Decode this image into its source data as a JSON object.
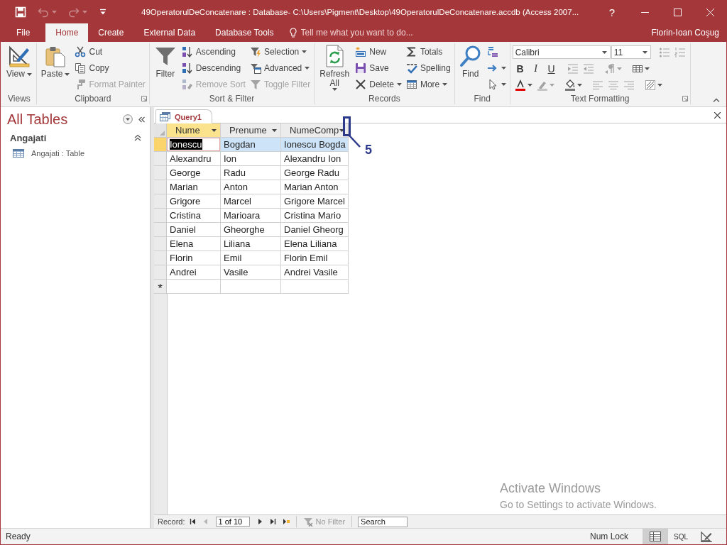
{
  "window": {
    "title": "49OperatorulDeConcatenare : Database- C:\\Users\\Pigment\\Desktop\\49OperatorulDeConcatenare.accdb (Access 2007...",
    "help": "?"
  },
  "quick_access": [
    {
      "kind": "save",
      "disabled": false,
      "dropdown": false
    },
    {
      "kind": "undo",
      "disabled": true,
      "dropdown": true
    },
    {
      "kind": "redo",
      "disabled": true,
      "dropdown": true
    },
    {
      "kind": "customize",
      "disabled": false,
      "dropdown": false
    }
  ],
  "ribbon_tabs": [
    {
      "label": "File",
      "selected": false
    },
    {
      "label": "Home",
      "selected": true
    },
    {
      "label": "Create",
      "selected": false
    },
    {
      "label": "External Data",
      "selected": false
    },
    {
      "label": "Database Tools",
      "selected": false
    }
  ],
  "tell_me": {
    "placeholder": "Tell me what you want to do..."
  },
  "user": "Florin-Ioan Coşug",
  "ribbon_groups": [
    {
      "label": "Views",
      "dialog_launcher": false,
      "large": {
        "kind": "view",
        "label": "View",
        "dropdown": true,
        "disabled": false
      }
    },
    {
      "label": "Clipboard",
      "dialog_launcher": true,
      "large": {
        "kind": "paste",
        "label": "Paste",
        "dropdown": true,
        "disabled": false
      },
      "columns": [
        [
          {
            "kind": "cut",
            "label": "Cut",
            "dropdown": false,
            "disabled": false
          },
          {
            "kind": "copy",
            "label": "Copy",
            "dropdown": false,
            "disabled": false
          },
          {
            "kind": "formatpainter",
            "label": "Format Painter",
            "dropdown": false,
            "disabled": true
          }
        ]
      ]
    },
    {
      "label": "Sort & Filter",
      "dialog_launcher": false,
      "large": {
        "kind": "filter",
        "label": "Filter",
        "dropdown": false,
        "disabled": false
      },
      "columns": [
        [
          {
            "kind": "ascending",
            "label": "Ascending",
            "dropdown": false,
            "disabled": false
          },
          {
            "kind": "descending",
            "label": "Descending",
            "dropdown": false,
            "disabled": false
          },
          {
            "kind": "removesort",
            "label": "Remove Sort",
            "dropdown": false,
            "disabled": true
          }
        ],
        [
          {
            "kind": "selection",
            "label": "Selection",
            "dropdown": true,
            "disabled": false
          },
          {
            "kind": "advanced",
            "label": "Advanced",
            "dropdown": true,
            "disabled": false
          },
          {
            "kind": "togglefilter",
            "label": "Toggle Filter",
            "dropdown": false,
            "disabled": true
          }
        ]
      ]
    },
    {
      "label": "Records",
      "dialog_launcher": false,
      "large": {
        "kind": "refresh",
        "label": "Refresh All",
        "dropdown": true,
        "disabled": false
      },
      "columns": [
        [
          {
            "kind": "new",
            "label": "New",
            "dropdown": false,
            "disabled": false
          },
          {
            "kind": "save",
            "label": "Save",
            "dropdown": false,
            "disabled": false
          },
          {
            "kind": "delete",
            "label": "Delete",
            "dropdown": true,
            "disabled": false
          }
        ],
        [
          {
            "kind": "totals",
            "label": "Totals",
            "dropdown": false,
            "disabled": false
          },
          {
            "kind": "spelling",
            "label": "Spelling",
            "dropdown": false,
            "disabled": false
          },
          {
            "kind": "more",
            "label": "More",
            "dropdown": true,
            "disabled": false
          }
        ]
      ]
    },
    {
      "label": "Find",
      "dialog_launcher": false,
      "large": {
        "kind": "find",
        "label": "Find",
        "dropdown": false,
        "disabled": false
      },
      "columns": [
        [
          {
            "kind": "replace",
            "dropdown": false,
            "disabled": false
          },
          {
            "kind": "goto",
            "dropdown": true,
            "disabled": false
          },
          {
            "kind": "select",
            "dropdown": true,
            "disabled": false
          }
        ]
      ]
    },
    {
      "label": "Text Formatting",
      "dialog_launcher": true,
      "toolbar_rows": [
        {
          "items": [
            {
              "kind": "font",
              "value": "Calibri",
              "disabled": false
            },
            {
              "kind": "size",
              "value": "11",
              "disabled": false
            },
            {
              "kind": "bullets",
              "disabled": true,
              "dropdown": false
            },
            {
              "kind": "numbering",
              "disabled": true,
              "dropdown": false
            }
          ]
        },
        {
          "items": [
            {
              "kind": "bold",
              "label": "B",
              "disabled": false
            },
            {
              "kind": "italic",
              "label": "I",
              "disabled": false
            },
            {
              "kind": "underline",
              "label": "U",
              "disabled": false
            },
            {
              "kind": "indent",
              "disabled": true,
              "dropdown": false
            },
            {
              "kind": "outdent",
              "disabled": true,
              "dropdown": false
            },
            {
              "kind": "rtl",
              "disabled": true,
              "dropdown": true
            },
            {
              "kind": "gridlines",
              "disabled": false,
              "dropdown": true
            }
          ]
        },
        {
          "items": [
            {
              "kind": "fontcolor",
              "disabled": false,
              "dropdown": true
            },
            {
              "kind": "highlight",
              "disabled": true,
              "dropdown": true
            },
            {
              "kind": "fill",
              "disabled": false,
              "dropdown": true
            },
            {
              "kind": "alignleft",
              "disabled": true,
              "dropdown": false
            },
            {
              "kind": "aligncenter",
              "disabled": true,
              "dropdown": false
            },
            {
              "kind": "alignright",
              "disabled": true,
              "dropdown": false
            },
            {
              "kind": "altrow",
              "disabled": false,
              "dropdown": true
            }
          ]
        }
      ]
    }
  ],
  "nav_pane": {
    "title": "All Tables",
    "groups": [
      {
        "label": "Angajati",
        "expanded": true,
        "items": [
          {
            "label": "Angajati : Table",
            "selected": false
          }
        ]
      }
    ]
  },
  "document_tabs": [
    {
      "label": "Query1",
      "selected": true
    }
  ],
  "datasheet": {
    "columns": [
      {
        "label": "Nume",
        "selected": true
      },
      {
        "label": "Prenume",
        "selected": false
      },
      {
        "label": "NumeComp",
        "selected": false
      }
    ],
    "rows": [
      {
        "selected": true,
        "cells": [
          "Ionescu",
          "Bogdan",
          "Ionescu Bogda"
        ]
      },
      {
        "selected": false,
        "cells": [
          "Alexandru",
          "Ion",
          "Alexandru Ion"
        ]
      },
      {
        "selected": false,
        "cells": [
          "George",
          "Radu",
          "George Radu"
        ]
      },
      {
        "selected": false,
        "cells": [
          "Marian",
          "Anton",
          "Marian Anton"
        ]
      },
      {
        "selected": false,
        "cells": [
          "Grigore",
          "Marcel",
          "Grigore Marcel"
        ]
      },
      {
        "selected": false,
        "cells": [
          "Cristina",
          "Marioara",
          "Cristina Mario"
        ]
      },
      {
        "selected": false,
        "cells": [
          "Daniel",
          "Gheorghe",
          "Daniel Gheorg"
        ]
      },
      {
        "selected": false,
        "cells": [
          "Elena",
          "Liliana",
          "Elena Liliana"
        ]
      },
      {
        "selected": false,
        "cells": [
          "Florin",
          "Emil",
          "Florin Emil"
        ]
      },
      {
        "selected": false,
        "cells": [
          "Andrei",
          "Vasile",
          "Andrei Vasile"
        ]
      }
    ],
    "new_record_marker": "*"
  },
  "annotation": {
    "label": "5"
  },
  "activation_notice": {
    "title": "Activate Windows",
    "text": "Go to Settings to activate Windows."
  },
  "record_navigation": {
    "label": "Record:",
    "controls": [
      {
        "kind": "first",
        "disabled": false
      },
      {
        "kind": "previous",
        "disabled": true
      },
      {
        "kind": "position",
        "value": "1 of 10",
        "disabled": false
      },
      {
        "kind": "next",
        "disabled": false
      },
      {
        "kind": "last",
        "disabled": false
      },
      {
        "kind": "new",
        "disabled": false
      }
    ],
    "filter": {
      "label": "No Filter",
      "active": false
    },
    "search": {
      "placeholder": "Search"
    }
  },
  "status_bar": {
    "text": "Ready",
    "indicators": [
      "Num Lock"
    ],
    "views": [
      {
        "kind": "datasheet",
        "selected": true
      },
      {
        "kind": "sql",
        "label": "SQL",
        "selected": false
      },
      {
        "kind": "design",
        "selected": false
      }
    ]
  }
}
